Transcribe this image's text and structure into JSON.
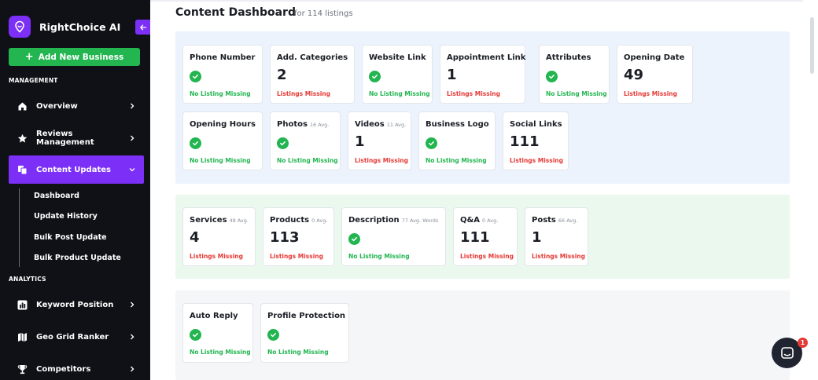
{
  "brand": {
    "name": "RightChoice AI",
    "logo_icon": "location-pin-icon"
  },
  "sidebar": {
    "add_button": "Add New Business",
    "sections": {
      "management": "MANAGEMENT",
      "analytics": "ANALYTICS"
    },
    "items": [
      {
        "label": "Overview",
        "icon": "home-icon"
      },
      {
        "label": "Reviews Management",
        "icon": "star-icon"
      },
      {
        "label": "Content Updates",
        "icon": "content-icon",
        "active": true
      },
      {
        "label": "Keyword Position",
        "icon": "bar-chart-icon"
      },
      {
        "label": "Geo Grid Ranker",
        "icon": "map-icon"
      },
      {
        "label": "Competitors",
        "icon": "trophy-icon"
      }
    ],
    "sub_items": [
      {
        "label": "Dashboard"
      },
      {
        "label": "Update History"
      },
      {
        "label": "Bulk Post Update"
      },
      {
        "label": "Bulk Product Update"
      }
    ]
  },
  "header": {
    "title": "Content Dashboard",
    "subtitle": "for 114 listings"
  },
  "groups": [
    {
      "color": "#ecf3fd",
      "cards": [
        {
          "title": "Phone Number",
          "avg": "",
          "value": "",
          "check": true,
          "status": "No Listing Missing",
          "status_type": "ok"
        },
        {
          "title": "Add. Categories",
          "avg": "",
          "value": "2",
          "check": false,
          "status": "Listings Missing",
          "status_type": "missing"
        },
        {
          "title": "Website Link",
          "avg": "",
          "value": "",
          "check": true,
          "status": "No Listing Missing",
          "status_type": "ok"
        },
        {
          "title": "Appointment Link",
          "avg": "",
          "value": "1",
          "check": false,
          "status": "Listings Missing",
          "status_type": "missing"
        },
        {
          "title": "Attributes",
          "avg": "",
          "value": "",
          "check": true,
          "status": "No Listing Missing",
          "status_type": "ok"
        },
        {
          "title": "Opening Date",
          "avg": "",
          "value": "49",
          "check": false,
          "status": "Listings Missing",
          "status_type": "missing"
        },
        {
          "title": "Opening Hours",
          "avg": "",
          "value": "",
          "check": true,
          "status": "No Listing Missing",
          "status_type": "ok"
        },
        {
          "title": "Photos",
          "avg": "16 Avg.",
          "value": "",
          "check": true,
          "status": "No Listing Missing",
          "status_type": "ok"
        },
        {
          "title": "Videos",
          "avg": "11 Avg.",
          "value": "1",
          "check": false,
          "status": "Listings Missing",
          "status_type": "missing"
        },
        {
          "title": "Business Logo",
          "avg": "",
          "value": "",
          "check": true,
          "status": "No Listing Missing",
          "status_type": "ok"
        },
        {
          "title": "Social Links",
          "avg": "",
          "value": "111",
          "check": false,
          "status": "Listings Missing",
          "status_type": "missing"
        }
      ]
    },
    {
      "color": "#eaf8ee",
      "cards": [
        {
          "title": "Services",
          "avg": "48 Avg.",
          "value": "4",
          "check": false,
          "status": "Listings Missing",
          "status_type": "missing"
        },
        {
          "title": "Products",
          "avg": "0 Avg.",
          "value": "113",
          "check": false,
          "status": "Listings Missing",
          "status_type": "missing"
        },
        {
          "title": "Description",
          "avg": "77 Avg. Words",
          "value": "",
          "check": true,
          "status": "No Listing Missing",
          "status_type": "ok"
        },
        {
          "title": "Q&A",
          "avg": "0 Avg.",
          "value": "111",
          "check": false,
          "status": "Listings Missing",
          "status_type": "missing"
        },
        {
          "title": "Posts",
          "avg": "66 Avg.",
          "value": "1",
          "check": false,
          "status": "Listings Missing",
          "status_type": "missing"
        }
      ]
    },
    {
      "color": "#f5f6f8",
      "cards": [
        {
          "title": "Auto Reply",
          "avg": "",
          "value": "",
          "check": true,
          "status": "No Listing Missing",
          "status_type": "ok"
        },
        {
          "title": "Profile Protection",
          "avg": "",
          "value": "",
          "check": true,
          "status": "No Listing Missing",
          "status_type": "ok"
        }
      ]
    }
  ],
  "chat": {
    "badge": "1",
    "icon": "chat-icon"
  },
  "colors": {
    "accent": "#7b2ff7",
    "success": "#22b550",
    "danger": "#e53935",
    "sidebar_bg": "#0f1117"
  }
}
